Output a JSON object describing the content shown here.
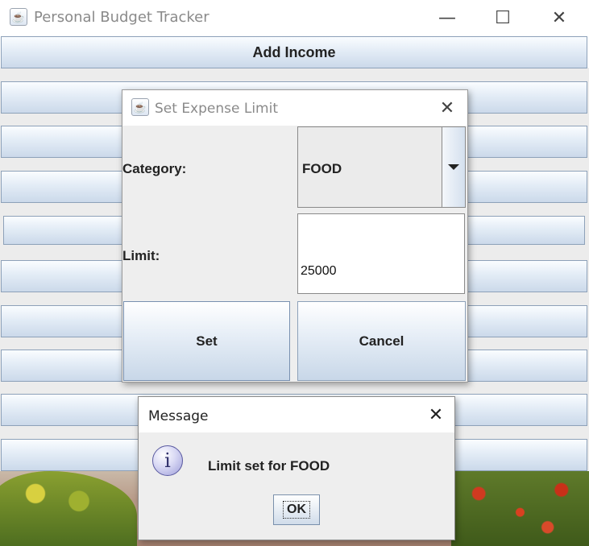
{
  "main_window": {
    "title": "Personal Budget Tracker",
    "icon": "java-icon",
    "controls": {
      "minimize": "—",
      "maximize": "☐",
      "close": "✕"
    },
    "buttons": [
      {
        "label": "Add Income"
      },
      {
        "label": ""
      },
      {
        "label": ""
      },
      {
        "label": ""
      },
      {
        "label": ""
      },
      {
        "label": ""
      },
      {
        "label": ""
      },
      {
        "label": ""
      },
      {
        "label": ""
      },
      {
        "label": ""
      }
    ]
  },
  "expense_limit_dialog": {
    "title": "Set Expense Limit",
    "icon": "java-icon",
    "close": "✕",
    "category_label": "Category:",
    "category_value": "FOOD",
    "limit_label": "Limit:",
    "limit_value": "25000",
    "set_button": "Set",
    "cancel_button": "Cancel"
  },
  "message_dialog": {
    "title": "Message",
    "close": "✕",
    "icon": "info-icon",
    "icon_glyph": "i",
    "text": "Limit set for FOOD",
    "ok_button": "OK"
  }
}
